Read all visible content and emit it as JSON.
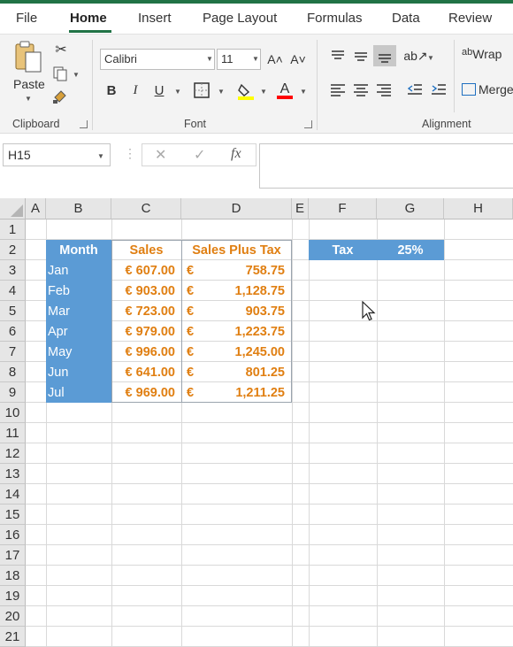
{
  "tabs": [
    "File",
    "Home",
    "Insert",
    "Page Layout",
    "Formulas",
    "Data",
    "Review"
  ],
  "ribbon": {
    "paste_label": "Paste",
    "clipboard_label": "Clipboard",
    "font_label": "Font",
    "alignment_label": "Alignment",
    "font_name": "Calibri",
    "font_size": "11",
    "wrap_label": "Wrap",
    "merge_label": "Merge",
    "wrap_prefix": "ab",
    "bold": "B",
    "italic": "I",
    "underline": "U",
    "grow_font": "A˄",
    "shrink_font": "A˅"
  },
  "formula_bar": {
    "name_box": "H15",
    "fx": "fx",
    "formula": ""
  },
  "columns": [
    "A",
    "B",
    "C",
    "D",
    "E",
    "F",
    "G",
    "H"
  ],
  "rows": [
    "1",
    "2",
    "3",
    "4",
    "5",
    "6",
    "7",
    "8",
    "9",
    "10",
    "11",
    "12",
    "13",
    "14",
    "15",
    "16",
    "17",
    "18",
    "19",
    "20",
    "21"
  ],
  "table": {
    "headers": [
      "Month",
      "Sales",
      "Sales Plus Tax"
    ],
    "rows": [
      {
        "month": "Jan",
        "sales": "€ 607.00",
        "cur": "€",
        "plus_tax": "758.75"
      },
      {
        "month": "Feb",
        "sales": "€ 903.00",
        "cur": "€",
        "plus_tax": "1,128.75"
      },
      {
        "month": "Mar",
        "sales": "€ 723.00",
        "cur": "€",
        "plus_tax": "903.75"
      },
      {
        "month": "Apr",
        "sales": "€ 979.00",
        "cur": "€",
        "plus_tax": "1,223.75"
      },
      {
        "month": "May",
        "sales": "€ 996.00",
        "cur": "€",
        "plus_tax": "1,245.00"
      },
      {
        "month": "Jun",
        "sales": "€ 641.00",
        "cur": "€",
        "plus_tax": "801.25"
      },
      {
        "month": "Jul",
        "sales": "€ 969.00",
        "cur": "€",
        "plus_tax": "1,211.25"
      }
    ]
  },
  "tax": {
    "label": "Tax",
    "value": "25%"
  },
  "colors": {
    "accent": "#217346",
    "table_blue": "#5b9bd5",
    "orange": "#e07f12",
    "highlight_yellow": "#ffff00",
    "font_red": "#ff0000"
  }
}
